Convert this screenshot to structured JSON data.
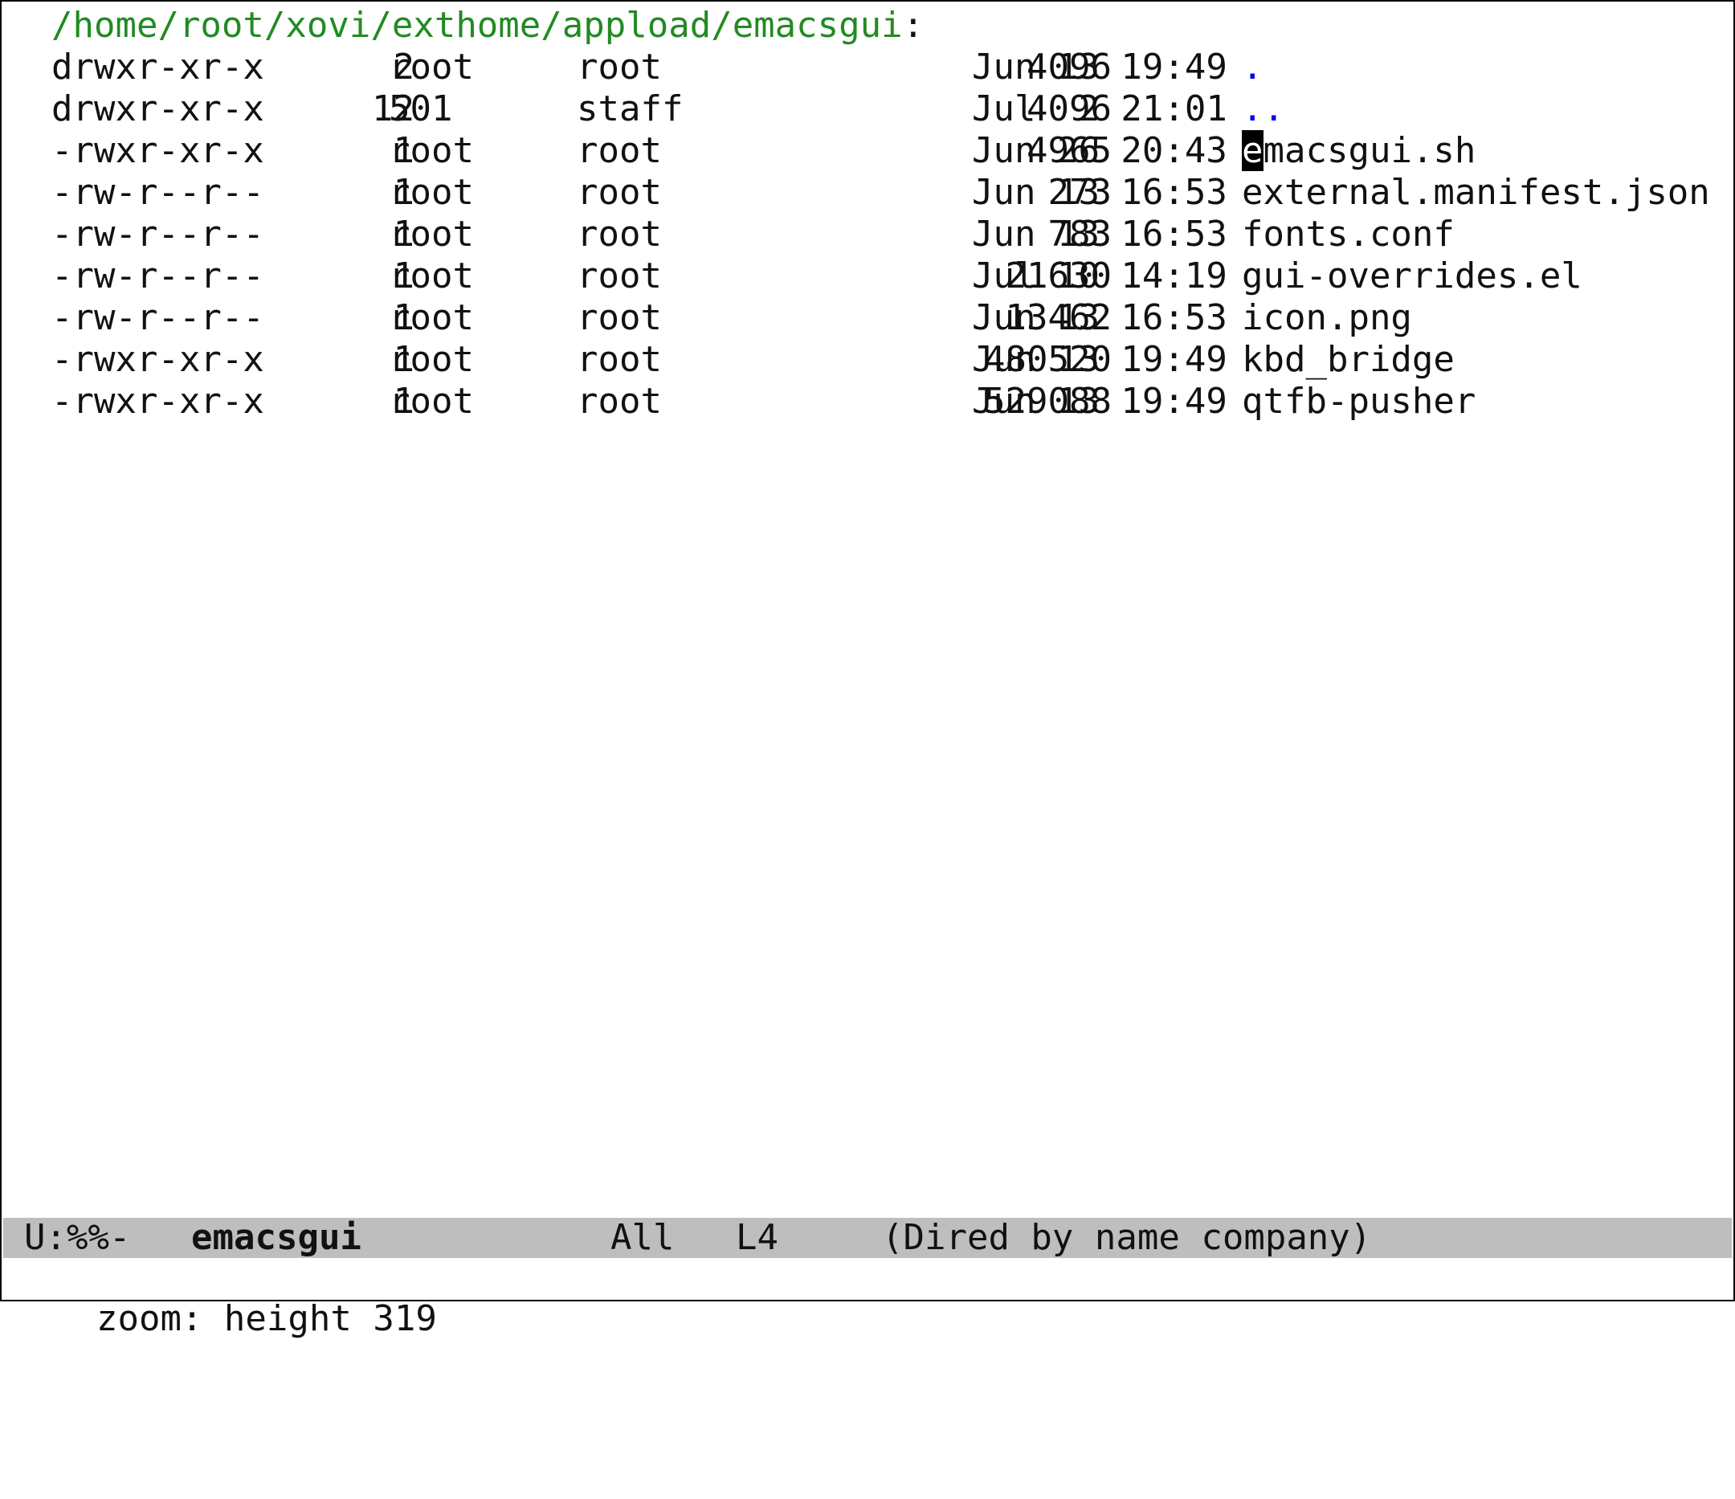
{
  "window": {
    "buffer_name": "emacsgui"
  },
  "dired": {
    "directory": "/home/root/xovi/exthome/appload/emacsgui",
    "directory_suffix": ":",
    "entries": [
      {
        "perms": "drwxr-xr-x",
        "links": "2",
        "owner": "root",
        "group": "root",
        "size": "4096",
        "date": "Jun 13 19:49",
        "name": ".",
        "is_dir": true
      },
      {
        "perms": "drwxr-xr-x",
        "links": "12",
        "owner": "501",
        "group": "staff",
        "size": "4096",
        "date": "Jul  2 21:01",
        "name": "..",
        "is_dir": true
      },
      {
        "perms": "-rwxr-xr-x",
        "links": "1",
        "owner": "root",
        "group": "root",
        "size": "4965",
        "date": "Jun 26 20:43",
        "name": "emacsgui.sh",
        "name_first": "e",
        "name_rest": "macsgui.sh",
        "has_cursor": true
      },
      {
        "perms": "-rw-r--r--",
        "links": "1",
        "owner": "root",
        "group": "root",
        "size": "273",
        "date": "Jun 13 16:53",
        "name": "external.manifest.json"
      },
      {
        "perms": "-rw-r--r--",
        "links": "1",
        "owner": "root",
        "group": "root",
        "size": "783",
        "date": "Jun 13 16:53",
        "name": "fonts.conf"
      },
      {
        "perms": "-rw-r--r--",
        "links": "1",
        "owner": "root",
        "group": "root",
        "size": "21630",
        "date": "Jul 10 14:19",
        "name": "gui-overrides.el"
      },
      {
        "perms": "-rw-r--r--",
        "links": "1",
        "owner": "root",
        "group": "root",
        "size": "13462",
        "date": "Jun 13 16:53",
        "name": "icon.png"
      },
      {
        "perms": "-rwxr-xr-x",
        "links": "1",
        "owner": "root",
        "group": "root",
        "size": "480520",
        "date": "Jun 13 19:49",
        "name": "kbd_bridge"
      },
      {
        "perms": "-rwxr-xr-x",
        "links": "1",
        "owner": "root",
        "group": "root",
        "size": "529088",
        "date": "Jun 13 19:49",
        "name": "qtfb-pusher"
      }
    ]
  },
  "modeline": {
    "status": "U:%%-",
    "buffer": "emacsgui",
    "position": "All",
    "line": "L4",
    "mode": "(Dired by name company)"
  },
  "echo_area": {
    "message": "zoom: height 319"
  },
  "colors": {
    "path": "#228b22",
    "directory": "#0000ee",
    "modeline_bg": "#bebebe",
    "cursor_bg": "#000000"
  }
}
